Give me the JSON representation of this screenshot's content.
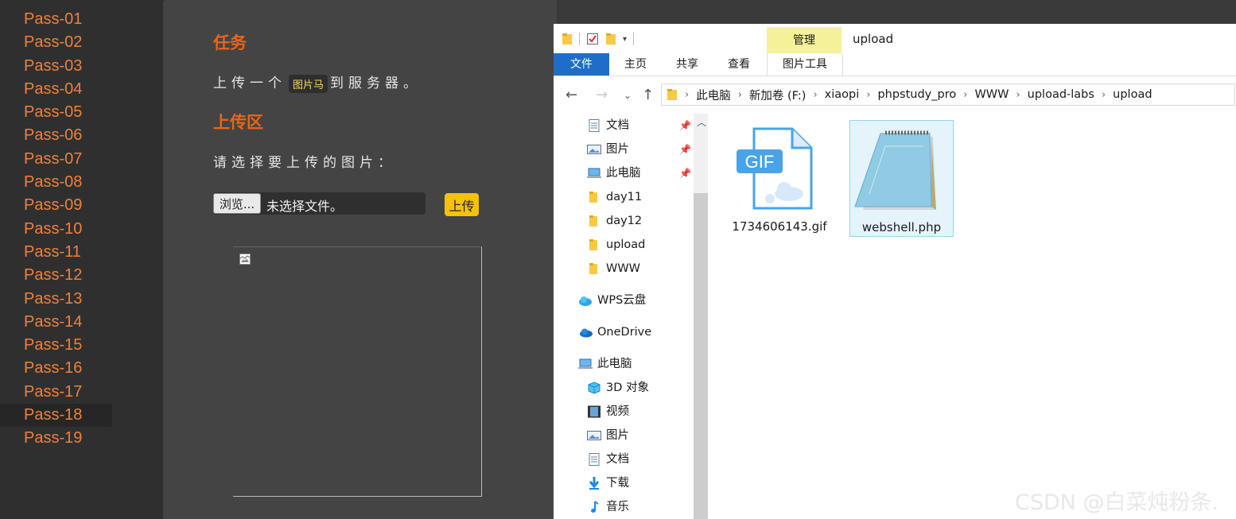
{
  "sidebar": {
    "items": [
      "Pass-01",
      "Pass-02",
      "Pass-03",
      "Pass-04",
      "Pass-05",
      "Pass-06",
      "Pass-07",
      "Pass-08",
      "Pass-09",
      "Pass-10",
      "Pass-11",
      "Pass-12",
      "Pass-13",
      "Pass-14",
      "Pass-15",
      "Pass-16",
      "Pass-17",
      "Pass-18",
      "Pass-19"
    ],
    "active": "Pass-18"
  },
  "main": {
    "task_heading": "任务",
    "task_text_before": "上传一个",
    "task_tag": "图片马",
    "task_text_after": "到服务器。",
    "upload_heading": "上传区",
    "choose_prompt": "请选择要上传的图片：",
    "browse_label": "浏览...",
    "file_status": "未选择文件。",
    "upload_button": "上传"
  },
  "explorer": {
    "title": "upload",
    "context_tab_group": "管理",
    "ribbon_tabs": [
      "文件",
      "主页",
      "共享",
      "查看",
      "图片工具"
    ],
    "breadcrumb": [
      "此电脑",
      "新加卷 (F:)",
      "xiaopi",
      "phpstudy_pro",
      "WWW",
      "upload-labs",
      "upload"
    ],
    "nav": {
      "quick_access": [
        {
          "label": "文档",
          "icon": "document-icon",
          "pinned": true
        },
        {
          "label": "图片",
          "icon": "pictures-icon",
          "pinned": true
        },
        {
          "label": "此电脑",
          "icon": "computer-icon",
          "pinned": true
        },
        {
          "label": "day11",
          "icon": "folder-icon",
          "pinned": false
        },
        {
          "label": "day12",
          "icon": "folder-icon",
          "pinned": false
        },
        {
          "label": "upload",
          "icon": "folder-icon",
          "pinned": false
        },
        {
          "label": "WWW",
          "icon": "folder-icon",
          "pinned": false
        }
      ],
      "wps": "WPS云盘",
      "onedrive": "OneDrive",
      "this_pc": "此电脑",
      "pc_items": [
        {
          "label": "3D 对象",
          "icon": "3d-objects-icon"
        },
        {
          "label": "视频",
          "icon": "video-icon"
        },
        {
          "label": "图片",
          "icon": "pictures-icon"
        },
        {
          "label": "文档",
          "icon": "document-icon"
        },
        {
          "label": "下载",
          "icon": "download-icon"
        },
        {
          "label": "音乐",
          "icon": "music-icon"
        }
      ]
    },
    "files": [
      {
        "name": "1734606143.gif",
        "icon": "gif-file-icon",
        "badge": "GIF",
        "selected": false
      },
      {
        "name": "webshell.php",
        "icon": "notepad-file-icon",
        "selected": true
      }
    ]
  },
  "watermark": "CSDN @白菜炖粉条."
}
